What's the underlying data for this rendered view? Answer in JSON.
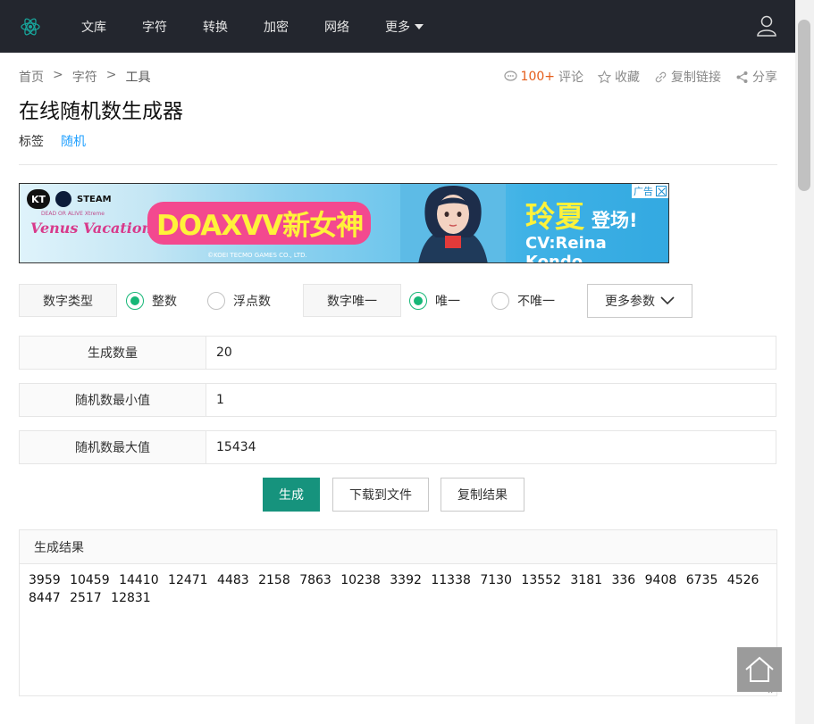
{
  "nav": {
    "items": [
      "文库",
      "字符",
      "转换",
      "加密",
      "网络"
    ],
    "more": "更多"
  },
  "breadcrumb": {
    "home": "首页",
    "category": "字符",
    "current": "工具"
  },
  "actions": {
    "comment_count": "100+",
    "comment": "评论",
    "favorite": "收藏",
    "copy_link": "复制链接",
    "share": "分享"
  },
  "page": {
    "title": "在线随机数生成器",
    "tag_label": "标签",
    "tag": "随机"
  },
  "ad": {
    "brand": "KT",
    "steam": "STEAM",
    "game": "Venus Vacation",
    "game_sub": "DEAD OR ALIVE Xtreme",
    "headline": "DOAXVV新女神",
    "copyright": "©KOEI TECMO GAMES CO., LTD.",
    "name": "玲夏",
    "appear": "登场!",
    "cv": "CV:Reina Kondo",
    "ad_label": "广告"
  },
  "options": {
    "type_label": "数字类型",
    "type_int": "整数",
    "type_float": "浮点数",
    "unique_label": "数字唯一",
    "unique_yes": "唯一",
    "unique_no": "不唯一",
    "more_params": "更多参数"
  },
  "form": {
    "count_label": "生成数量",
    "count_value": "20",
    "min_label": "随机数最小值",
    "min_value": "1",
    "max_label": "随机数最大值",
    "max_value": "15434"
  },
  "buttons": {
    "generate": "生成",
    "download": "下载到文件",
    "copy": "复制结果"
  },
  "result": {
    "title": "生成结果",
    "text": "3959 10459 14410 12471 4483 2158 7863 10238 3392 11338 7130 13552 3181 336 9408 6735 4526 8447 2517 12831"
  }
}
